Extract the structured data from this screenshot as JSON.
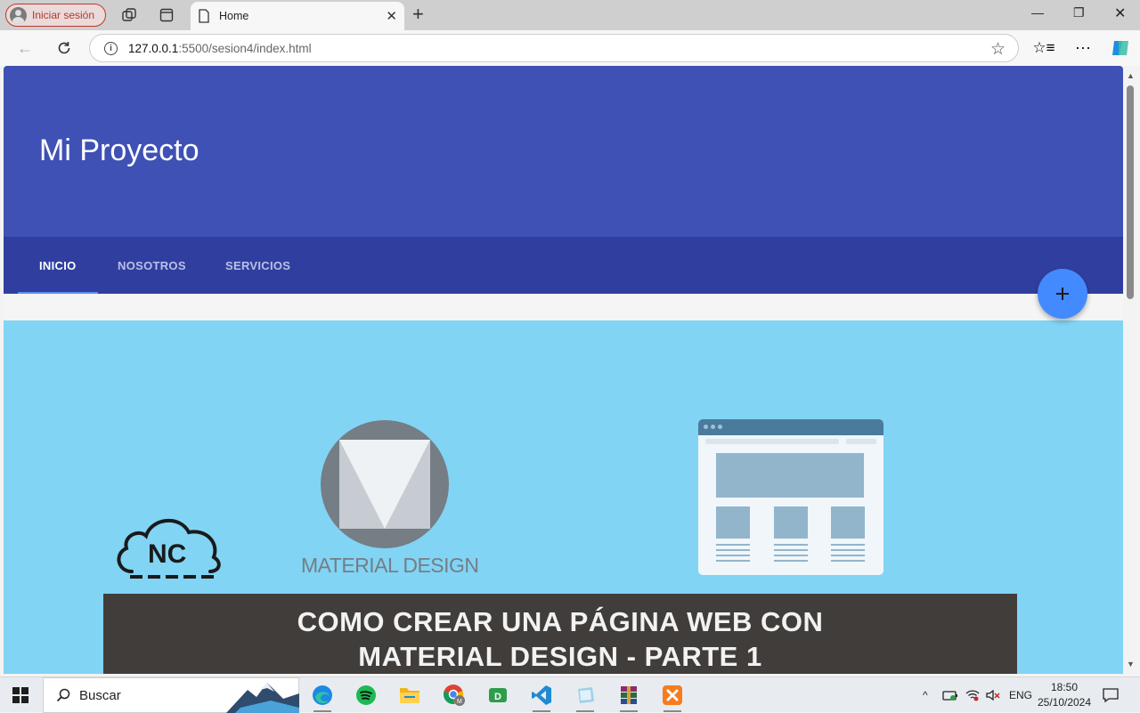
{
  "browser": {
    "profile_label": "Iniciar sesión",
    "tab_title": "Home",
    "url_host": "127.0.0.1",
    "url_path": ":5500/sesion4/index.html"
  },
  "page": {
    "hero_title": "Mi Proyecto",
    "tabs": [
      {
        "label": "INICIO",
        "active": true
      },
      {
        "label": "NOSOTROS",
        "active": false
      },
      {
        "label": "SERVICIOS",
        "active": false
      }
    ],
    "fab_label": "+",
    "banner": {
      "cloud_text": "NC",
      "logo_text": "MATERIAL DESIGN",
      "title_line1": "COMO CREAR UNA PÁGINA WEB CON",
      "title_line2": "MATERIAL DESIGN - PARTE 1"
    },
    "colors": {
      "primary": "#3f51b5",
      "primary_dark": "#303f9f",
      "accent": "#448aff",
      "banner_bg": "#81d4f4"
    }
  },
  "taskbar": {
    "search_label": "Buscar",
    "language": "ENG",
    "time": "18:50",
    "date": "25/10/2024",
    "apps": [
      "edge-icon",
      "spotify-icon",
      "file-explorer-icon",
      "chrome-icon",
      "dropbox-icon",
      "vscode-icon",
      "notepad-icon",
      "winrar-icon",
      "xampp-icon"
    ]
  }
}
